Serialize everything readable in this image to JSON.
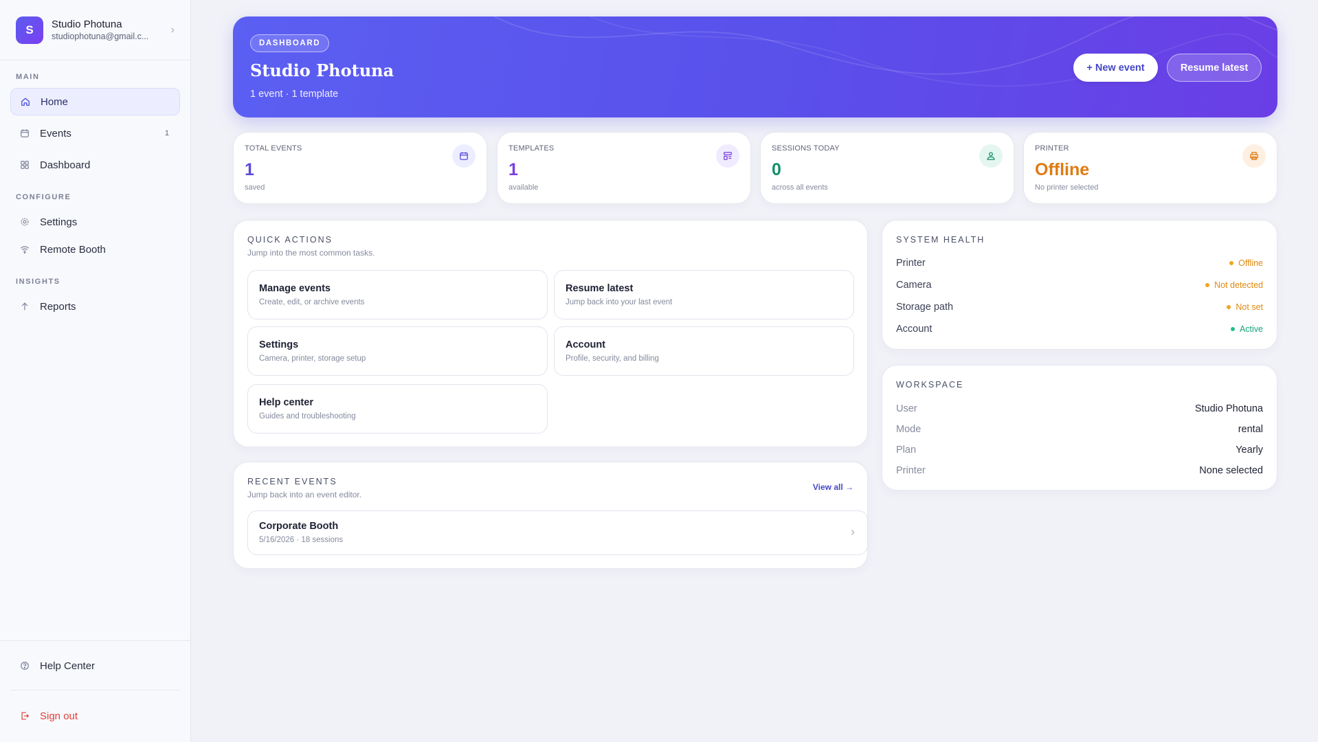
{
  "sidebar": {
    "profile": {
      "initial": "S",
      "name": "Studio Photuna",
      "email": "studiophotuna@gmail.c..."
    },
    "sections": {
      "main": "MAIN",
      "configure": "CONFIGURE",
      "insights": "INSIGHTS"
    },
    "items": {
      "home": "Home",
      "events": "Events",
      "events_count": "1",
      "dashboard": "Dashboard",
      "settings": "Settings",
      "remote_booth": "Remote Booth",
      "reports": "Reports",
      "help_center": "Help Center",
      "sign_out": "Sign out"
    }
  },
  "hero": {
    "tag": "DASHBOARD",
    "title": "Studio Photuna",
    "subtitle": "1 event · 1 template",
    "new_event": "+ New event",
    "resume_latest": "Resume latest"
  },
  "stats": [
    {
      "label": "TOTAL EVENTS",
      "value": "1",
      "sub": "saved",
      "icon": "calendar-icon",
      "color": "#5b4bdb"
    },
    {
      "label": "TEMPLATES",
      "value": "1",
      "sub": "available",
      "icon": "template-icon",
      "color": "#7a3fe0"
    },
    {
      "label": "SESSIONS TODAY",
      "value": "0",
      "sub": "across all events",
      "icon": "user-icon",
      "color": "#12906a"
    },
    {
      "label": "PRINTER",
      "value": "Offline",
      "sub": "No printer selected",
      "icon": "printer-icon",
      "color": "#e07a12"
    }
  ],
  "quick_actions": {
    "title": "QUICK ACTIONS",
    "subtitle": "Jump into the most common tasks.",
    "items": [
      {
        "title": "Manage events",
        "sub": "Create, edit, or archive events"
      },
      {
        "title": "Resume latest",
        "sub": "Jump back into your last event"
      },
      {
        "title": "Settings",
        "sub": "Camera, printer, storage setup"
      },
      {
        "title": "Account",
        "sub": "Profile, security, and billing"
      },
      {
        "title": "Help center",
        "sub": "Guides and troubleshooting"
      }
    ]
  },
  "recent_events": {
    "title": "RECENT EVENTS",
    "subtitle": "Jump back into an event editor.",
    "view_all": "View all →",
    "events": [
      {
        "name": "Corporate Booth",
        "meta": "5/16/2026 · 18 sessions"
      }
    ]
  },
  "system_health": {
    "title": "SYSTEM HEALTH",
    "rows": [
      {
        "key": "Printer",
        "value": "Offline",
        "color": "#e0890f"
      },
      {
        "key": "Camera",
        "value": "Not detected",
        "color": "#e0890f"
      },
      {
        "key": "Storage path",
        "value": "Not set",
        "color": "#e0890f"
      },
      {
        "key": "Account",
        "value": "Active",
        "color": "#14a37a"
      }
    ]
  },
  "workspace": {
    "title": "WORKSPACE",
    "rows": [
      {
        "key": "User",
        "value": "Studio Photuna"
      },
      {
        "key": "Mode",
        "value": "rental"
      },
      {
        "key": "Plan",
        "value": "Yearly"
      },
      {
        "key": "Printer",
        "value": "None selected"
      }
    ]
  },
  "colors": {
    "accent": "#5b5ff2",
    "accent_dark": "#6a3ee6",
    "danger": "#e0403a"
  }
}
